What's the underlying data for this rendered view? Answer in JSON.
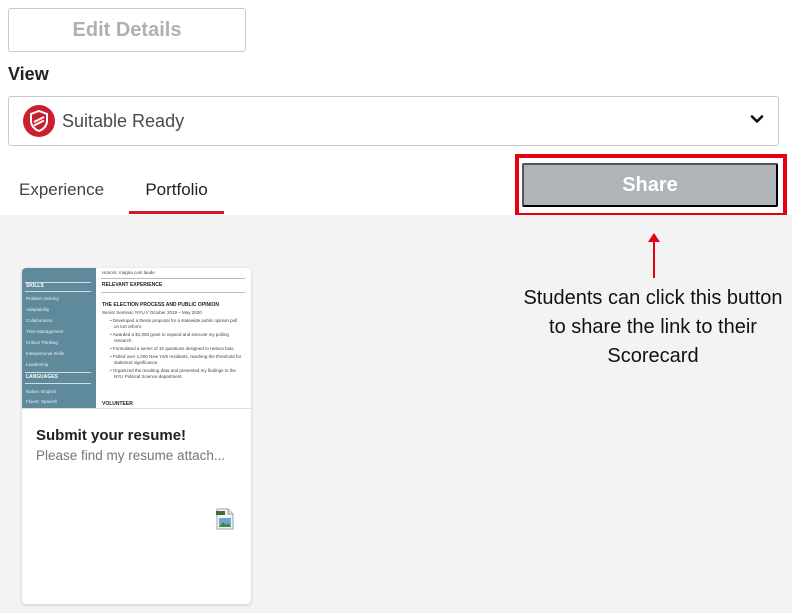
{
  "header": {
    "edit_label": "Edit Details",
    "view_label": "View"
  },
  "view_select": {
    "selected": "Suitable Ready",
    "icon": "shield-logo-icon",
    "brand_color": "#c8202e"
  },
  "tabs": [
    {
      "label": "Experience",
      "active": false
    },
    {
      "label": "Portfolio",
      "active": true
    }
  ],
  "share": {
    "label": "Share",
    "highlight_color": "#e50012"
  },
  "card": {
    "title": "Submit your resume!",
    "description": "Please find my resume attach...",
    "attachment_icon": "image-file-icon",
    "thumbnail": {
      "sidebar": {
        "skills_heading": "SKILLS",
        "skills": [
          "Problem Solving",
          "Adaptability",
          "Collaboration",
          "Time Management",
          "Critical Thinking",
          "Interpersonal Skills",
          "Leadership"
        ],
        "languages_heading": "LANGUAGES",
        "languages": [
          "Native: English",
          "Fluent: Spanish"
        ]
      },
      "main": {
        "honors": "Honors: magna cum laude",
        "section_heading": "RELEVANT EXPERIENCE",
        "project_title": "THE ELECTION PROCESS AND PUBLIC OPINION",
        "project_meta": "Senior Seminar, NYU // October 2019 – May 2020",
        "bullets": [
          "Developed a thesis proposal for a statewide public opinion poll",
          "on tort reform.",
          "Awarded a $1,000 grant to expand and execute my polling",
          "research.",
          "Formulated a series of 15 questions designed to reduce bias.",
          "Polled over 1,000 New York residents, reaching the threshold for",
          "statistical significance.",
          "Organized the resulting data and presented my findings to the",
          "NYU Political Science department."
        ],
        "volunteer_heading": "VOLUNTEER"
      }
    }
  },
  "annotation": {
    "text": "Students can click this button to share the link to their Scorecard",
    "arrow_color": "#e50012"
  }
}
